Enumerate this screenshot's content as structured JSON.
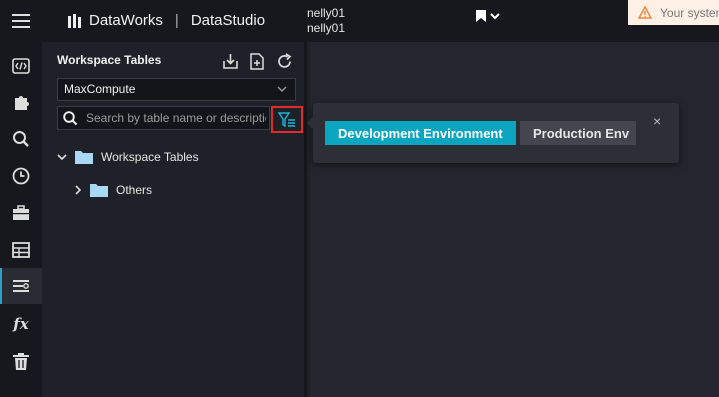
{
  "header": {
    "brand": "DataWorks",
    "separator": "|",
    "module": "DataStudio",
    "user_line1": "nelly01",
    "user_line2": "nelly01",
    "warning_text": "Your system"
  },
  "rail": {
    "icons": [
      "code-icon",
      "puzzle-icon",
      "search-icon",
      "clock-icon",
      "toolbox-icon",
      "table-icon",
      "list-filter-icon",
      "fx-icon",
      "trash-icon"
    ],
    "active_index": 6
  },
  "panel": {
    "title": "Workspace Tables",
    "engine_select": "MaxCompute",
    "search_placeholder": "Search by table name or description",
    "tree": [
      {
        "label": "Workspace Tables",
        "expanded": true
      },
      {
        "label": "Others",
        "expanded": false
      }
    ]
  },
  "popover": {
    "dev_label": "Development Environment",
    "prod_label": "Production Env",
    "close_symbol": "×"
  },
  "colors": {
    "accent": "#0ba5c0",
    "folder": "#a9d8f5",
    "highlight_border": "#e12b2b"
  }
}
